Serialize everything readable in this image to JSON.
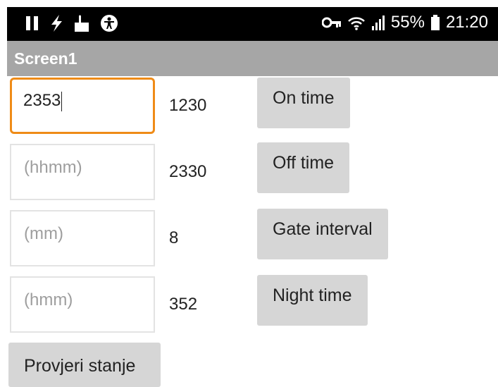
{
  "status_bar": {
    "icons_left": [
      "pause-icon",
      "flash-icon",
      "notification-icon",
      "accessibility-icon"
    ],
    "icons_right": [
      "vpn-key-icon",
      "wifi-icon",
      "signal-icon"
    ],
    "battery": "55%",
    "time": "21:20"
  },
  "app_bar": {
    "title": "Screen1"
  },
  "rows": [
    {
      "input_value": "2353",
      "placeholder": "",
      "display_value": "1230",
      "button_label": "On time"
    },
    {
      "input_value": "",
      "placeholder": "(hhmm)",
      "display_value": "2330",
      "button_label": "Off time"
    },
    {
      "input_value": "",
      "placeholder": "(mm)",
      "display_value": "8",
      "button_label": "Gate interval"
    },
    {
      "input_value": "",
      "placeholder": "(hmm)",
      "display_value": "352",
      "button_label": "Night time"
    }
  ],
  "check_button": {
    "label": "Provjeri stanje"
  },
  "colors": {
    "status_bar_bg": "#000000",
    "app_bar_bg": "#a6a6a6",
    "focus_border": "#ef8b17",
    "button_bg": "#d6d6d6"
  }
}
